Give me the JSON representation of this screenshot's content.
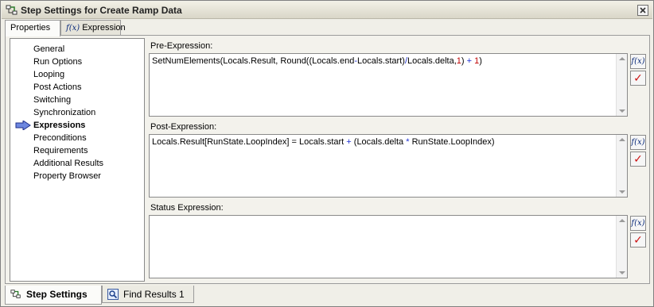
{
  "window": {
    "title": "Step Settings for Create Ramp Data",
    "close_icon": "close-icon"
  },
  "top_tabs": [
    {
      "label": "Properties",
      "active": true
    },
    {
      "label": "Expression",
      "active": false,
      "icon": "fx-icon"
    }
  ],
  "nav": {
    "items": [
      {
        "label": "General"
      },
      {
        "label": "Run Options"
      },
      {
        "label": "Looping"
      },
      {
        "label": "Post Actions"
      },
      {
        "label": "Switching"
      },
      {
        "label": "Synchronization"
      },
      {
        "label": "Expressions",
        "selected": true
      },
      {
        "label": "Preconditions"
      },
      {
        "label": "Requirements"
      },
      {
        "label": "Additional Results"
      },
      {
        "label": "Property Browser"
      }
    ],
    "selected_icon": "arrow-right-icon"
  },
  "sections": {
    "pre": {
      "label": "Pre-Expression:",
      "parts": [
        "SetNumElements(Locals.Result, Round((Locals.end",
        "-",
        "Locals.start)",
        "/",
        "Locals.delta,",
        "1",
        ")",
        " + ",
        "1",
        ")"
      ]
    },
    "post": {
      "label": "Post-Expression:",
      "parts": [
        "Locals.Result[RunState.LoopIndex] = Locals.start",
        " + ",
        "(Locals.delta",
        " * ",
        "RunState.LoopIndex)"
      ]
    },
    "status": {
      "label": "Status Expression:",
      "value": ""
    }
  },
  "side_buttons": {
    "fx_label": "f(x)",
    "check_label": "✓"
  },
  "bottom_tabs": [
    {
      "label": "Step Settings",
      "active": true,
      "icon": "step-settings-icon"
    },
    {
      "label": "Find Results 1",
      "active": false,
      "icon": "find-results-icon"
    }
  ]
}
